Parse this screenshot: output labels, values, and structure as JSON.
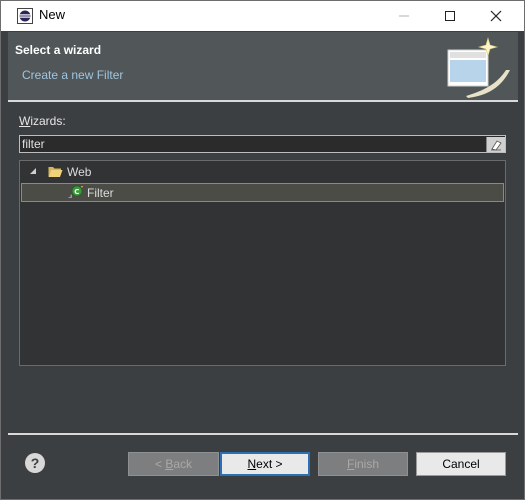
{
  "window": {
    "title": "New"
  },
  "header": {
    "title": "Select a wizard",
    "description": "Create a new Filter"
  },
  "wizards": {
    "label_prefix": "W",
    "label_rest": "izards:",
    "filter_value": "filter",
    "filter_placeholder": "",
    "tree": [
      {
        "label": "Web",
        "expanded": true,
        "icon": "folder-open-icon"
      },
      {
        "label": "Filter",
        "selected": true,
        "icon": "filter-icon"
      }
    ]
  },
  "footer": {
    "help_icon": "?",
    "back_prefix": "< ",
    "back_mnemonic": "B",
    "back_rest": "ack",
    "next_mnemonic": "N",
    "next_rest": "ext >",
    "finish_mnemonic": "F",
    "finish_rest": "inish",
    "cancel_label": "Cancel"
  },
  "colors": {
    "accent": "#2f6fb3",
    "header_bg": "#515658",
    "body_bg": "#3c3f41",
    "description": "#9fc6e0"
  }
}
